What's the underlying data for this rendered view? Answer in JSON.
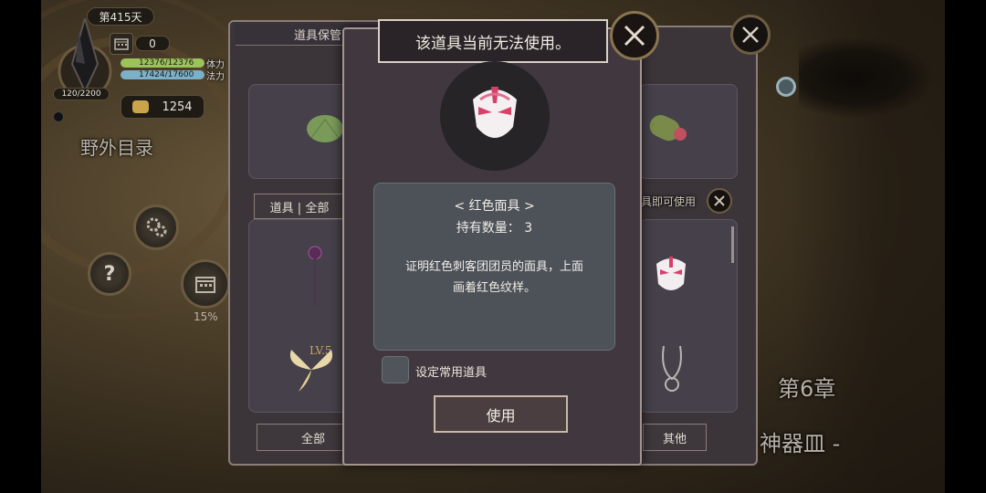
{
  "hud": {
    "day": "第415天",
    "calendar_count": "0",
    "hp": "12376/12376",
    "hp_label": "体力",
    "mp": "17424/17600",
    "mp_label": "法力",
    "exp": "120/2200",
    "coins": "1254",
    "progress": "15%"
  },
  "map": {
    "title": "野外目录",
    "chapter": "第6章",
    "chapter_subtitle": "神器皿 -"
  },
  "left_panel": {
    "header": "道具保管",
    "tab": "道具 | 全部",
    "bottom_tab": "全部",
    "level_badge": "LV.5"
  },
  "right_panel": {
    "hint": "具即可使用",
    "bottom_tab": "其他"
  },
  "modal": {
    "title": "该道具当前无法使用。",
    "item_name": "< 红色面具 >",
    "quantity": "持有数量： 3",
    "description_line1": "证明红色刺客团团员的面具，上面",
    "description_line2": "画着红色纹样。",
    "favorite_label": "设定常用道具",
    "use_button": "使用"
  },
  "colors": {
    "hp_bar": "#9cc35a",
    "mp_bar": "#7ab0c8",
    "mask_red": "#d8406a"
  }
}
